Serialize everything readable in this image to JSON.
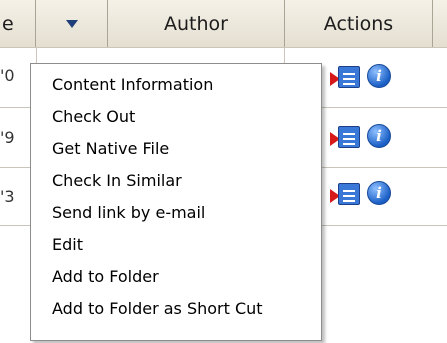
{
  "header": {
    "partial_label": "e",
    "author_label": "Author",
    "actions_label": "Actions"
  },
  "rows": [
    {
      "partial_value": "'0"
    },
    {
      "partial_value": "'9"
    },
    {
      "partial_value": "'3"
    }
  ],
  "context_menu": {
    "items": [
      "Content Information",
      "Check Out",
      "Get Native File",
      "Check In Similar",
      "Send link by e-mail",
      "Edit",
      "Add to Folder",
      "Add to Folder as Short Cut"
    ]
  },
  "icons": {
    "sort": "chevron-down-icon",
    "action_arrow": "red-arrow-icon",
    "action_list": "document-list-icon",
    "action_info": "info-icon"
  },
  "colors": {
    "header_bg": "#ece8dc",
    "caret": "#1f3f7a",
    "info_blue": "#1a5fc6",
    "arrow_red": "#d61a1a"
  }
}
